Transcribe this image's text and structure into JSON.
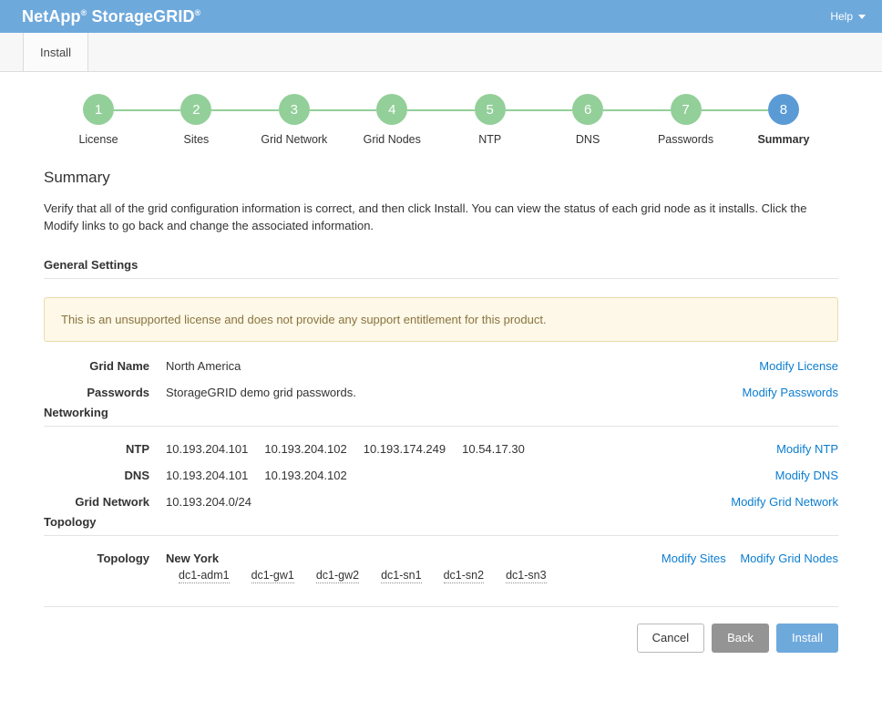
{
  "header": {
    "brand_main": "NetApp",
    "brand_sup1": "®",
    "brand_product": "StorageGRID",
    "brand_sup2": "®",
    "help_label": "Help",
    "help_icon": "chevron-down-icon",
    "accent_color": "#6ea9dc"
  },
  "tabs": [
    {
      "label": "Install"
    }
  ],
  "stepper": {
    "completed_color": "#93cf99",
    "active_color": "#5b9bd5",
    "steps": [
      {
        "number": "1",
        "label": "License",
        "state": "complete"
      },
      {
        "number": "2",
        "label": "Sites",
        "state": "complete"
      },
      {
        "number": "3",
        "label": "Grid Network",
        "state": "complete"
      },
      {
        "number": "4",
        "label": "Grid Nodes",
        "state": "complete"
      },
      {
        "number": "5",
        "label": "NTP",
        "state": "complete"
      },
      {
        "number": "6",
        "label": "DNS",
        "state": "complete"
      },
      {
        "number": "7",
        "label": "Passwords",
        "state": "complete"
      },
      {
        "number": "8",
        "label": "Summary",
        "state": "active"
      }
    ]
  },
  "main": {
    "title": "Summary",
    "description": "Verify that all of the grid configuration information is correct, and then click Install. You can view the status of each grid node as it installs. Click the Modify links to go back and change the associated information.",
    "general_settings": {
      "heading": "General Settings",
      "warning": {
        "text": "This is an unsupported license and does not provide any support entitlement for this product.",
        "bg_color": "#fdf8e7",
        "border_color": "#e9dcae",
        "text_color": "#8a7340"
      },
      "rows": [
        {
          "label": "Grid Name",
          "value": "North America",
          "action": "Modify License"
        },
        {
          "label": "Passwords",
          "value": "StorageGRID demo grid passwords.",
          "action": "Modify Passwords"
        }
      ]
    },
    "networking": {
      "heading": "Networking",
      "ntp": {
        "label": "NTP",
        "servers": [
          "10.193.204.101",
          "10.193.204.102",
          "10.193.174.249",
          "10.54.17.30"
        ],
        "action": "Modify NTP"
      },
      "dns": {
        "label": "DNS",
        "servers": [
          "10.193.204.101",
          "10.193.204.102"
        ],
        "action": "Modify DNS"
      },
      "grid_network": {
        "label": "Grid Network",
        "subnet": "10.193.204.0/24",
        "action": "Modify Grid Network"
      }
    },
    "topology": {
      "heading": "Topology",
      "label": "Topology",
      "site": "New York",
      "nodes": [
        "dc1-adm1",
        "dc1-gw1",
        "dc1-gw2",
        "dc1-sn1",
        "dc1-sn2",
        "dc1-sn3"
      ],
      "action_sites": "Modify Sites",
      "action_nodes": "Modify Grid Nodes"
    }
  },
  "footer": {
    "cancel_label": "Cancel",
    "back_label": "Back",
    "install_label": "Install"
  }
}
